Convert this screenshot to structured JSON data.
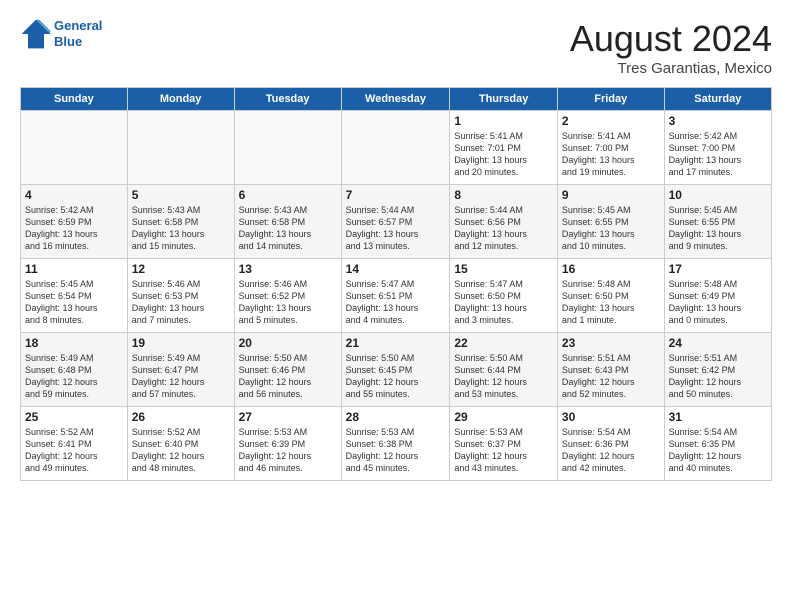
{
  "header": {
    "logo_line1": "General",
    "logo_line2": "Blue",
    "month_title": "August 2024",
    "subtitle": "Tres Garantias, Mexico"
  },
  "days_of_week": [
    "Sunday",
    "Monday",
    "Tuesday",
    "Wednesday",
    "Thursday",
    "Friday",
    "Saturday"
  ],
  "weeks": [
    [
      {
        "date": "",
        "text": ""
      },
      {
        "date": "",
        "text": ""
      },
      {
        "date": "",
        "text": ""
      },
      {
        "date": "",
        "text": ""
      },
      {
        "date": "1",
        "text": "Sunrise: 5:41 AM\nSunset: 7:01 PM\nDaylight: 13 hours\nand 20 minutes."
      },
      {
        "date": "2",
        "text": "Sunrise: 5:41 AM\nSunset: 7:00 PM\nDaylight: 13 hours\nand 19 minutes."
      },
      {
        "date": "3",
        "text": "Sunrise: 5:42 AM\nSunset: 7:00 PM\nDaylight: 13 hours\nand 17 minutes."
      }
    ],
    [
      {
        "date": "4",
        "text": "Sunrise: 5:42 AM\nSunset: 6:59 PM\nDaylight: 13 hours\nand 16 minutes."
      },
      {
        "date": "5",
        "text": "Sunrise: 5:43 AM\nSunset: 6:58 PM\nDaylight: 13 hours\nand 15 minutes."
      },
      {
        "date": "6",
        "text": "Sunrise: 5:43 AM\nSunset: 6:58 PM\nDaylight: 13 hours\nand 14 minutes."
      },
      {
        "date": "7",
        "text": "Sunrise: 5:44 AM\nSunset: 6:57 PM\nDaylight: 13 hours\nand 13 minutes."
      },
      {
        "date": "8",
        "text": "Sunrise: 5:44 AM\nSunset: 6:56 PM\nDaylight: 13 hours\nand 12 minutes."
      },
      {
        "date": "9",
        "text": "Sunrise: 5:45 AM\nSunset: 6:55 PM\nDaylight: 13 hours\nand 10 minutes."
      },
      {
        "date": "10",
        "text": "Sunrise: 5:45 AM\nSunset: 6:55 PM\nDaylight: 13 hours\nand 9 minutes."
      }
    ],
    [
      {
        "date": "11",
        "text": "Sunrise: 5:45 AM\nSunset: 6:54 PM\nDaylight: 13 hours\nand 8 minutes."
      },
      {
        "date": "12",
        "text": "Sunrise: 5:46 AM\nSunset: 6:53 PM\nDaylight: 13 hours\nand 7 minutes."
      },
      {
        "date": "13",
        "text": "Sunrise: 5:46 AM\nSunset: 6:52 PM\nDaylight: 13 hours\nand 5 minutes."
      },
      {
        "date": "14",
        "text": "Sunrise: 5:47 AM\nSunset: 6:51 PM\nDaylight: 13 hours\nand 4 minutes."
      },
      {
        "date": "15",
        "text": "Sunrise: 5:47 AM\nSunset: 6:50 PM\nDaylight: 13 hours\nand 3 minutes."
      },
      {
        "date": "16",
        "text": "Sunrise: 5:48 AM\nSunset: 6:50 PM\nDaylight: 13 hours\nand 1 minute."
      },
      {
        "date": "17",
        "text": "Sunrise: 5:48 AM\nSunset: 6:49 PM\nDaylight: 13 hours\nand 0 minutes."
      }
    ],
    [
      {
        "date": "18",
        "text": "Sunrise: 5:49 AM\nSunset: 6:48 PM\nDaylight: 12 hours\nand 59 minutes."
      },
      {
        "date": "19",
        "text": "Sunrise: 5:49 AM\nSunset: 6:47 PM\nDaylight: 12 hours\nand 57 minutes."
      },
      {
        "date": "20",
        "text": "Sunrise: 5:50 AM\nSunset: 6:46 PM\nDaylight: 12 hours\nand 56 minutes."
      },
      {
        "date": "21",
        "text": "Sunrise: 5:50 AM\nSunset: 6:45 PM\nDaylight: 12 hours\nand 55 minutes."
      },
      {
        "date": "22",
        "text": "Sunrise: 5:50 AM\nSunset: 6:44 PM\nDaylight: 12 hours\nand 53 minutes."
      },
      {
        "date": "23",
        "text": "Sunrise: 5:51 AM\nSunset: 6:43 PM\nDaylight: 12 hours\nand 52 minutes."
      },
      {
        "date": "24",
        "text": "Sunrise: 5:51 AM\nSunset: 6:42 PM\nDaylight: 12 hours\nand 50 minutes."
      }
    ],
    [
      {
        "date": "25",
        "text": "Sunrise: 5:52 AM\nSunset: 6:41 PM\nDaylight: 12 hours\nand 49 minutes."
      },
      {
        "date": "26",
        "text": "Sunrise: 5:52 AM\nSunset: 6:40 PM\nDaylight: 12 hours\nand 48 minutes."
      },
      {
        "date": "27",
        "text": "Sunrise: 5:53 AM\nSunset: 6:39 PM\nDaylight: 12 hours\nand 46 minutes."
      },
      {
        "date": "28",
        "text": "Sunrise: 5:53 AM\nSunset: 6:38 PM\nDaylight: 12 hours\nand 45 minutes."
      },
      {
        "date": "29",
        "text": "Sunrise: 5:53 AM\nSunset: 6:37 PM\nDaylight: 12 hours\nand 43 minutes."
      },
      {
        "date": "30",
        "text": "Sunrise: 5:54 AM\nSunset: 6:36 PM\nDaylight: 12 hours\nand 42 minutes."
      },
      {
        "date": "31",
        "text": "Sunrise: 5:54 AM\nSunset: 6:35 PM\nDaylight: 12 hours\nand 40 minutes."
      }
    ]
  ]
}
